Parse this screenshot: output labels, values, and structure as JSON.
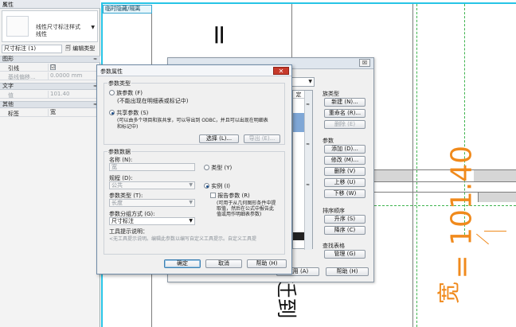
{
  "properties_panel": {
    "title": "属性",
    "close": "✕",
    "type_name_line1": "线性尺寸标注样式",
    "type_name_line2": "线性",
    "instance_selector": "尺寸标注 (1)",
    "edit_type": "编辑类型",
    "groups": [
      {
        "name": "图形",
        "toggle": "≈",
        "rows": [
          {
            "key": "引线",
            "value": "☑"
          },
          {
            "key": "基线偏移...",
            "value": "0.0000 mm"
          }
        ]
      },
      {
        "name": "文字",
        "toggle": "≈",
        "rows": [
          {
            "key": "值",
            "value": "101.40"
          }
        ]
      },
      {
        "name": "其他",
        "toggle": "≈",
        "rows": [
          {
            "key": "标签",
            "value": "宽"
          }
        ]
      }
    ]
  },
  "view": {
    "tab_label": "临时隐藏/隔离",
    "big_text_top": "= 1",
    "big_text_bottom": "迁到",
    "dimension_text": "= 101.40",
    "dimension_label": "宽"
  },
  "back_dialog": {
    "close": "☒",
    "column_header": "定",
    "family_types_label": "族类型",
    "family_type_buttons": [
      "新建 (N)...",
      "重命名 (R)...",
      "删除 (E)"
    ],
    "params_label": "参数",
    "param_buttons": [
      "添加 (D)...",
      "修改 (M)...",
      "删除 (V)",
      "上移 (U)",
      "下移 (W)"
    ],
    "sort_label": "排序顺序",
    "sort_buttons": [
      "升序 (S)",
      "降序 (C)"
    ],
    "lookup_label": "查找表格",
    "lookup_button": "管理 (G)",
    "apply_button": "应用 (A)",
    "help_button": "帮助 (H)"
  },
  "dialog": {
    "title": "参数属性",
    "close": "✕",
    "param_type_legend": "参数类型",
    "family_param_label": "族参数 (F)",
    "family_param_desc": "(不能出现在明细表或标记中)",
    "shared_param_label": "共享参数 (S)",
    "shared_param_desc_1": "(可以由多个项目和族共享，可以导出到 ODBC，并且可以出现在明细表",
    "shared_param_desc_2": "和标记中)",
    "select_button": "选择 (L)...",
    "export_button": "导出 (E)...",
    "param_data_legend": "参数数据",
    "name_label": "名称 (N):",
    "name_value": "宽",
    "type_radio": "类型 (Y)",
    "discipline_label": "规程 (D):",
    "discipline_value": "公共",
    "instance_radio": "实例 (I)",
    "param_type_label": "参数类型 (T):",
    "param_type_value": "长度",
    "report_param": "报告参数 (R)",
    "report_desc_1": "(可用于从几何图形条件中提",
    "report_desc_2": "取值，然后在公式中报告此",
    "report_desc_3": "值或用作明细表参数)",
    "group_label": "参数分组方式 (G):",
    "group_value": "尺寸标注",
    "tooltip_label": "工具提示说明：",
    "tooltip_text": "<无工具提示说明。编辑此参数以编写自定义工具提示。自定义工具提",
    "ok": "确定",
    "cancel": "取消",
    "help": "帮助 (H)"
  }
}
